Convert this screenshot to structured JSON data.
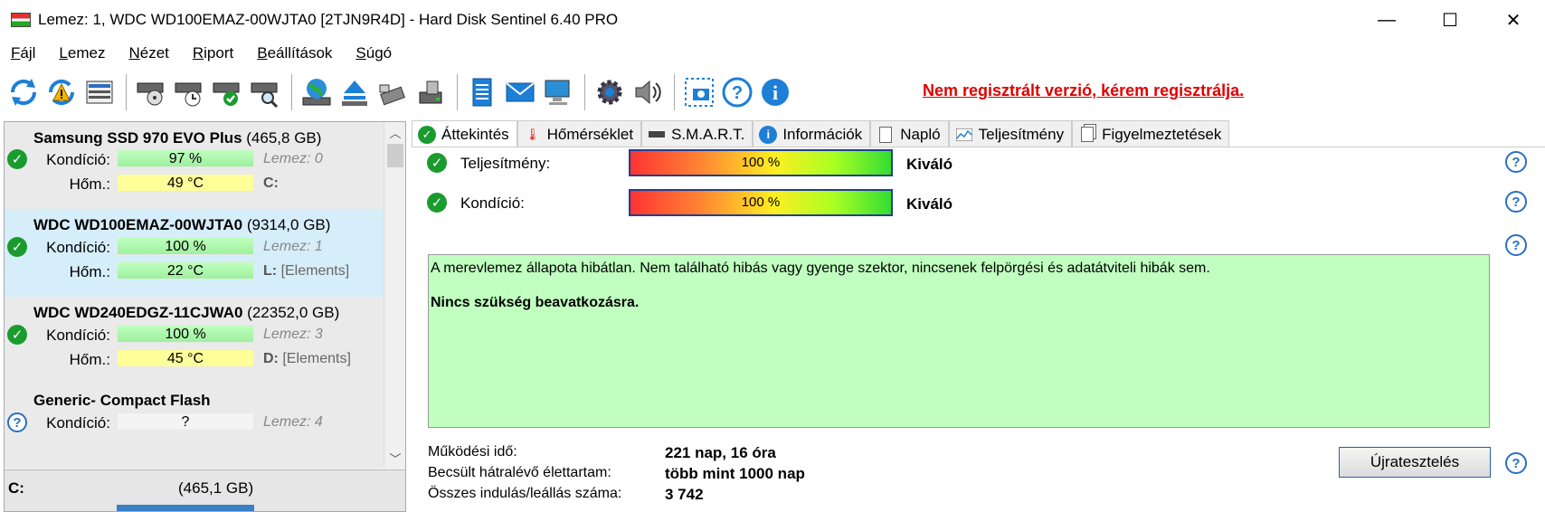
{
  "window": {
    "title": "Lemez: 1, WDC WD100EMAZ-00WJTA0 [2TJN9R4D]  -  Hard Disk Sentinel 6.40 PRO",
    "minimize": "—",
    "maximize": "☐",
    "close": "✕"
  },
  "menu": [
    {
      "first": "F",
      "rest": "ájl"
    },
    {
      "first": "L",
      "rest": "emez"
    },
    {
      "first": "N",
      "rest": "ézet"
    },
    {
      "first": "R",
      "rest": "iport"
    },
    {
      "first": "B",
      "rest": "eállítások"
    },
    {
      "first": "S",
      "rest": "úgó"
    }
  ],
  "toolbar": {
    "icons": [
      "refresh-icon",
      "refresh-warning-icon",
      "disk-info-icon",
      "disk-test-icon",
      "disk-schedule-icon",
      "disk-ok-icon",
      "disk-search-icon",
      "globe-icon",
      "eject-icon",
      "usb-icon",
      "drive-icon",
      "report-icon",
      "mail-icon",
      "computer-icon",
      "settings-icon",
      "sound-icon",
      "screenshot-icon",
      "help-icon",
      "info-icon"
    ],
    "unregistered_text": "Nem regisztrált verzió, kérem regisztrálja."
  },
  "disks": [
    {
      "name": "Samsung SSD 970 EVO Plus",
      "size": "(465,8 GB)",
      "condition_label": "Kondíció:",
      "condition": "97 %",
      "condition_disk": "Lemez: 0",
      "temp_label": "Hőm.:",
      "temp": "49 °C",
      "drive_letter": "C:",
      "drive_name": ""
    },
    {
      "name": "WDC WD100EMAZ-00WJTA0",
      "size": "(9314,0 GB)",
      "condition_label": "Kondíció:",
      "condition": "100 %",
      "condition_disk": "Lemez: 1",
      "temp_label": "Hőm.:",
      "temp": "22 °C",
      "drive_letter": "L:",
      "drive_name": "[Elements]"
    },
    {
      "name": "WDC WD240EDGZ-11CJWA0",
      "size": "(22352,0 GB)",
      "condition_label": "Kondíció:",
      "condition": "100 %",
      "condition_disk": "Lemez: 3",
      "temp_label": "Hőm.:",
      "temp": "45 °C",
      "drive_letter": "D:",
      "drive_name": "[Elements]"
    },
    {
      "name": "Generic- Compact Flash",
      "size": "",
      "condition_label": "Kondíció:",
      "condition": "?",
      "condition_disk": "Lemez: 4"
    }
  ],
  "partition": {
    "name": "C:",
    "size": "(465,1 GB)"
  },
  "tabs": [
    "Áttekintés",
    "Hőmérséklet",
    "S.M.A.R.T.",
    "Információk",
    "Napló",
    "Teljesítmény",
    "Figyelmeztetések"
  ],
  "overview": {
    "performance_label": "Teljesítmény:",
    "performance_value": "100 %",
    "performance_word": "Kiváló",
    "condition_label": "Kondíció:",
    "condition_value": "100 %",
    "condition_word": "Kiváló",
    "message_line1": "A merevlemez állapota hibátlan. Nem található hibás vagy gyenge szektor, nincsenek felpörgési és adatátviteli hibák sem.",
    "message_line2": "Nincs szükség beavatkozásra.",
    "uptime_label": "Működési idő:",
    "uptime_value": "221 nap, 16 óra",
    "remaining_label": "Becsült hátralévő élettartam:",
    "remaining_value": "több mint 1000 nap",
    "starts_label": "Összes indulás/leállás száma:",
    "starts_value": "3 742",
    "retest_button": "Újratesztelés",
    "help_glyph": "?"
  },
  "colors": {
    "accent_red": "#e00000",
    "ok_green": "#1a9b2e",
    "selected_row": "#d6eefa",
    "message_bg": "#c0ffc0",
    "temp_yellow": "#ffff9a"
  }
}
